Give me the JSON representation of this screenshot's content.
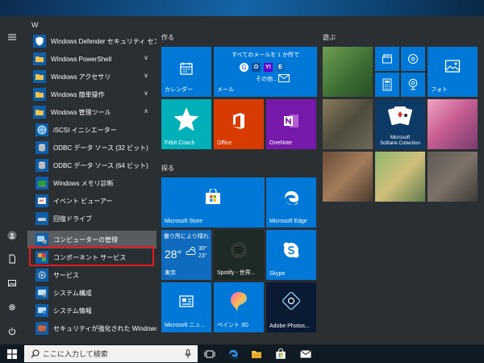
{
  "start_menu": {
    "letter_header": "W",
    "apps": [
      {
        "label": "Windows Defender セキュリティ センター",
        "icon": "shield-icon"
      },
      {
        "label": "Windows PowerShell",
        "icon": "folder-icon",
        "chevron": "∨"
      },
      {
        "label": "Windows アクセサリ",
        "icon": "folder-icon",
        "chevron": "∨"
      },
      {
        "label": "Windows 簡単操作",
        "icon": "folder-icon",
        "chevron": "∨"
      },
      {
        "label": "Windows 管理ツール",
        "icon": "folder-icon",
        "chevron": "∧"
      },
      {
        "label": "iSCSI イニシエーター",
        "icon": "globe-icon"
      },
      {
        "label": "ODBC データ ソース (32 ビット)",
        "icon": "database-icon"
      },
      {
        "label": "ODBC データ ソース (64 ビット)",
        "icon": "database-icon"
      },
      {
        "label": "Windows メモリ診断",
        "icon": "memory-icon"
      },
      {
        "label": "イベント ビューアー",
        "icon": "event-viewer-icon"
      },
      {
        "label": "回復ドライブ",
        "icon": "drive-icon"
      },
      {
        "label": "コンピューターの管理",
        "icon": "computer-management-icon"
      },
      {
        "label": "コンポーネント サービス",
        "icon": "component-icon"
      },
      {
        "label": "サービス",
        "icon": "gear-icon"
      },
      {
        "label": "システム構成",
        "icon": "config-icon"
      },
      {
        "label": "システム情報",
        "icon": "info-icon"
      },
      {
        "label": "セキュリティが強化された Windows De...",
        "icon": "firewall-icon"
      }
    ]
  },
  "tiles": {
    "group1_title": "作る",
    "group2_title": "探る",
    "group3_title": "遊ぶ",
    "calendar": "カレンダー",
    "mail_top": "すべてのメールを 1 か所で",
    "mail_other": "その他...",
    "mail": "メール",
    "fitbit": "Fitbit Coach",
    "office": "Office",
    "onenote": "OneNote",
    "store": "Microsoft Store",
    "edge": "Microsoft Edge",
    "weather_cond": "曇り所により晴れ",
    "weather_temp": "28°",
    "weather_hi": "30°",
    "weather_lo": "23°",
    "weather_city": "東京",
    "spotify": "Spotify - 世界...",
    "skype": "Skype",
    "news": "Microsoft ニュ...",
    "paint3d": "ペイント 3D",
    "adobe": "Adobe Photos...",
    "photos": "フォト",
    "solitaire": "Microsoft\nSolitaire Collection"
  },
  "taskbar": {
    "search_placeholder": "ここに入力して検索"
  },
  "colors": {
    "tile_blue": "#0078d7",
    "office_red": "#d83b01",
    "onenote_purple": "#7719aa",
    "fitbit_teal": "#00b0b9",
    "highlight_red": "#e41a1c"
  }
}
